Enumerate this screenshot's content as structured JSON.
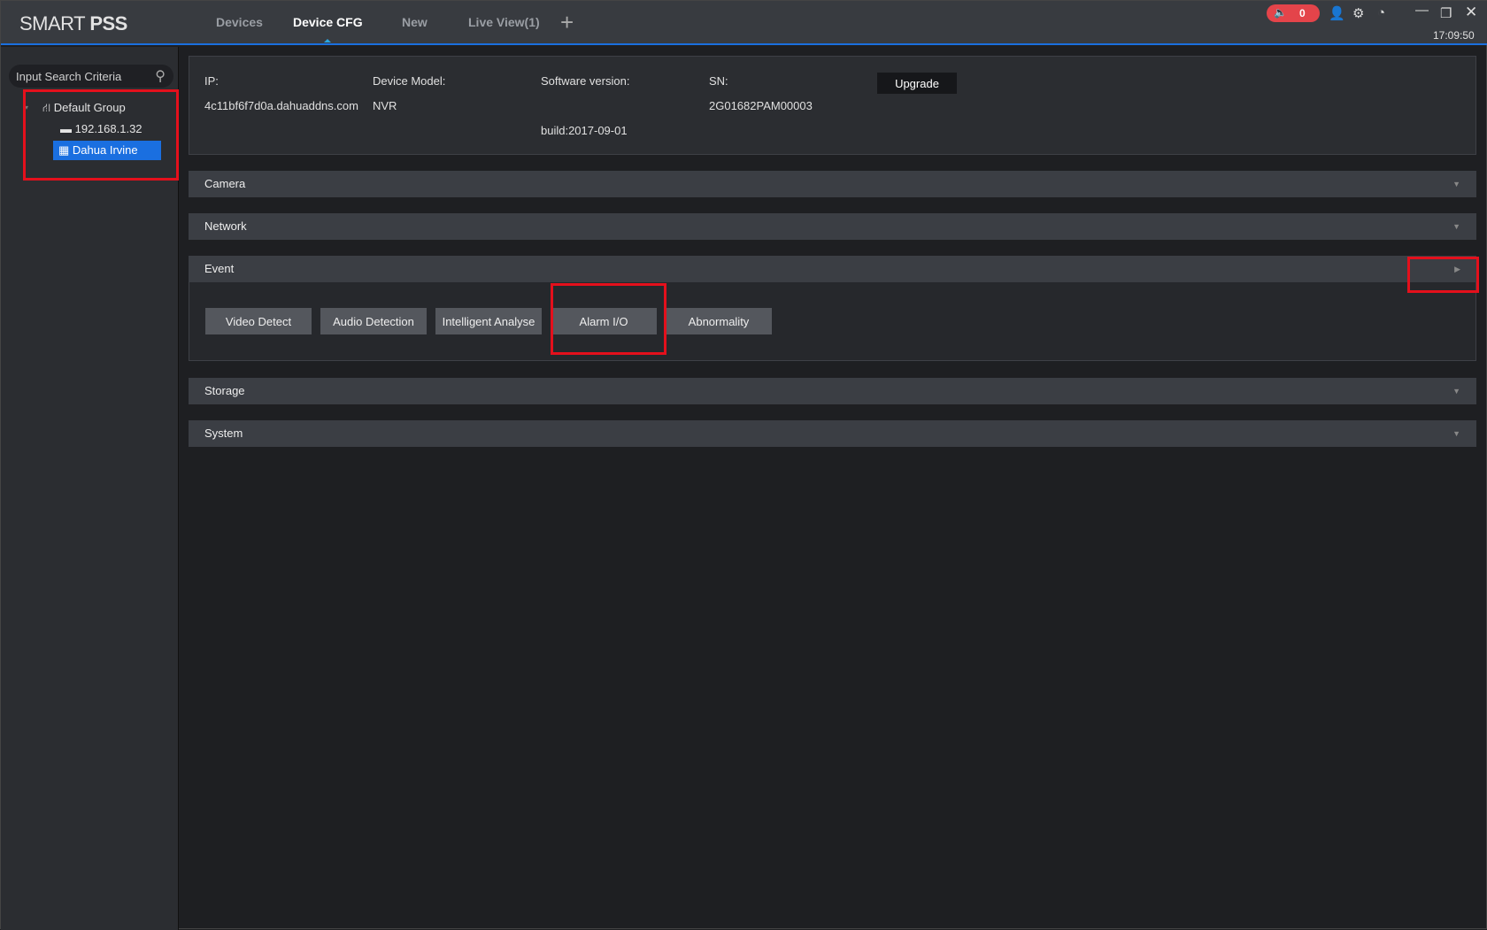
{
  "app": {
    "logo_light": "SMART ",
    "logo_bold": "PSS",
    "clock": "17:09:50",
    "alarm_count": "0"
  },
  "tabs": [
    {
      "label": "Devices"
    },
    {
      "label": "Device CFG"
    },
    {
      "label": "New"
    },
    {
      "label": "Live View(1)"
    }
  ],
  "sidebar": {
    "search_placeholder": "Input Search Criteria",
    "group": "Default Group",
    "devices": [
      "192.168.1.32",
      "Dahua Irvine"
    ]
  },
  "info": {
    "ip_label": "IP:",
    "ip": "4c11bf6f7d0a.dahuaddns.com",
    "model_label": "Device Model:",
    "model": "NVR",
    "sw_label": "Software version:",
    "sw_build": "build:2017-09-01",
    "sn_label": "SN:",
    "sn": "2G01682PAM00003",
    "upgrade": "Upgrade"
  },
  "sections": {
    "camera": "Camera",
    "network": "Network",
    "event": "Event",
    "storage": "Storage",
    "system": "System"
  },
  "event_buttons": [
    "Video Detect",
    "Audio Detection",
    "Intelligent Analyse",
    "Alarm I/O",
    "Abnormality"
  ],
  "colors": {
    "accent": "#1a6fe0",
    "alarm": "#e4444a",
    "highlight": "#e4101c"
  }
}
